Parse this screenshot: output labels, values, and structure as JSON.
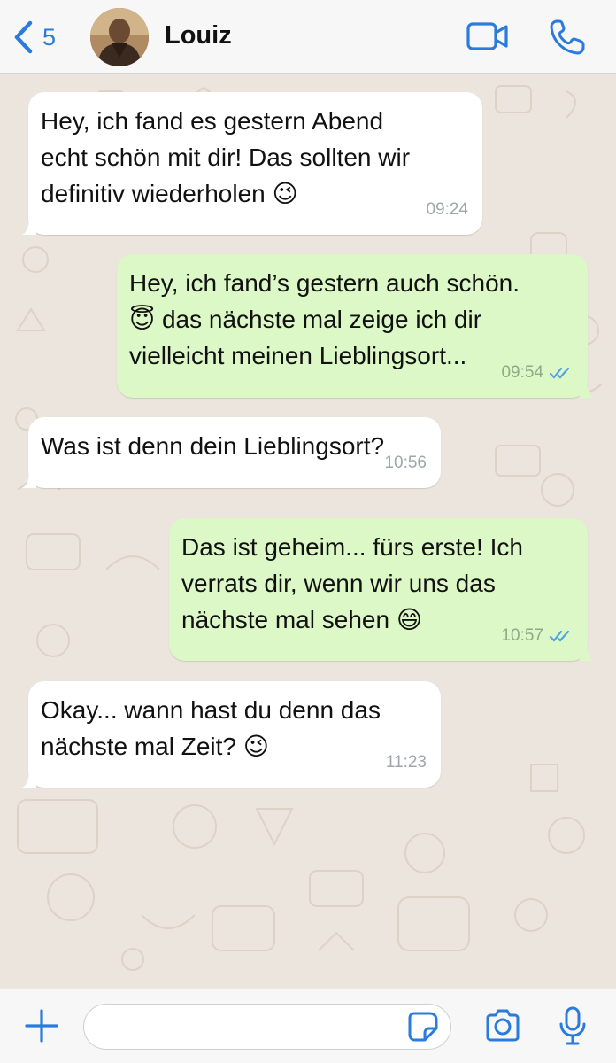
{
  "header": {
    "back_count": "5",
    "contact_name": "Louiz",
    "icons": [
      "chevron-left-icon",
      "video-call-icon",
      "phone-icon"
    ]
  },
  "messages": [
    {
      "direction": "incoming",
      "lines": [
        "Hey, ich fand es gestern Abend",
        "echt schön mit dir! Das sollten wir",
        "definitiv wiederholen 😉"
      ],
      "time": "09:24"
    },
    {
      "direction": "outgoing",
      "lines": [
        "Hey, ich fand’s gestern auch schön.",
        "😇 das nächste mal zeige ich dir",
        "vielleicht meinen Lieblingsort..."
      ],
      "time": "09:54",
      "status": "read"
    },
    {
      "direction": "incoming",
      "lines": [
        "Was ist denn dein Lieblingsort?"
      ],
      "time": "10:56"
    },
    {
      "direction": "outgoing",
      "lines": [
        "Das ist geheim... fürs erste! Ich",
        "verrats dir, wenn wir uns das",
        "nächste mal sehen 😄"
      ],
      "time": "10:57",
      "status": "read"
    },
    {
      "direction": "incoming",
      "lines": [
        "Okay... wann hast du denn das",
        "nächste mal Zeit? 😉"
      ],
      "time": "11:23"
    }
  ],
  "input": {
    "value": "",
    "placeholder": ""
  },
  "colors": {
    "accent": "#2a7bdc",
    "outgoing_bubble": "#dcf8c6",
    "incoming_bubble": "#ffffff",
    "chat_background": "#ece5dd",
    "read_ticks": "#4fa3e0"
  }
}
